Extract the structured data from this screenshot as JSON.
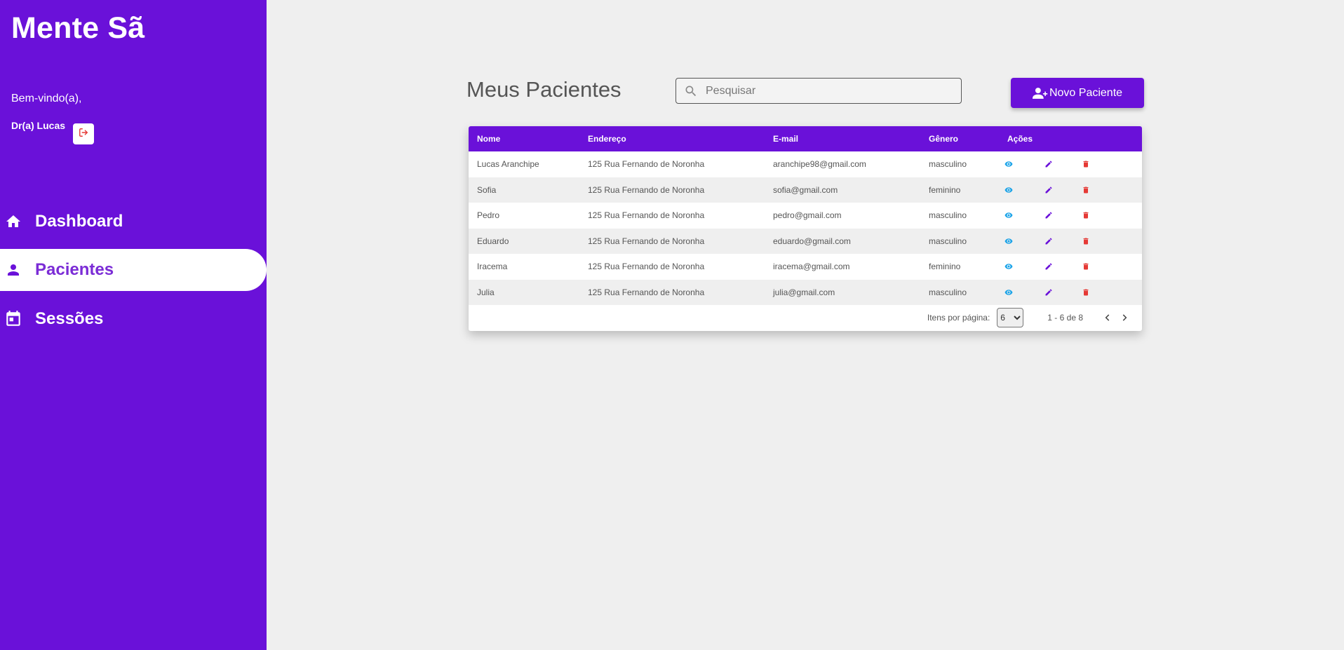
{
  "sidebar": {
    "brand": "Mente Sã",
    "welcome": "Bem-vindo(a),",
    "user": "Dr(a) Lucas",
    "nav": [
      {
        "label": "Dashboard",
        "icon": "home-icon"
      },
      {
        "label": "Pacientes",
        "icon": "person-icon"
      },
      {
        "label": "Sessões",
        "icon": "calendar-icon"
      }
    ],
    "active_index": 1
  },
  "main": {
    "title": "Meus Pacientes",
    "search_placeholder": "Pesquisar",
    "new_button": "Novo Paciente"
  },
  "table": {
    "columns": [
      "Nome",
      "Endereço",
      "E-mail",
      "Gênero",
      "Ações"
    ],
    "rows": [
      {
        "nome": "Lucas Aranchipe",
        "endereco": "125 Rua Fernando de Noronha",
        "email": "aranchipe98@gmail.com",
        "genero": "masculino"
      },
      {
        "nome": "Sofia",
        "endereco": "125 Rua Fernando de Noronha",
        "email": "sofia@gmail.com",
        "genero": "feminino"
      },
      {
        "nome": "Pedro",
        "endereco": "125 Rua Fernando de Noronha",
        "email": "pedro@gmail.com",
        "genero": "masculino"
      },
      {
        "nome": "Eduardo",
        "endereco": "125 Rua Fernando de Noronha",
        "email": "eduardo@gmail.com",
        "genero": "masculino"
      },
      {
        "nome": "Iracema",
        "endereco": "125 Rua Fernando de Noronha",
        "email": "iracema@gmail.com",
        "genero": "feminino"
      },
      {
        "nome": "Julia",
        "endereco": "125 Rua Fernando de Noronha",
        "email": "julia@gmail.com",
        "genero": "masculino"
      }
    ],
    "action_icons": [
      "view-icon",
      "edit-icon",
      "delete-icon"
    ]
  },
  "paginator": {
    "label": "Itens por página:",
    "page_size": "6",
    "range": "1 - 6 de 8"
  },
  "colors": {
    "primary": "#6a11d9",
    "view": "#1aa3e8",
    "edit": "#6a11d9",
    "delete": "#e53935"
  }
}
